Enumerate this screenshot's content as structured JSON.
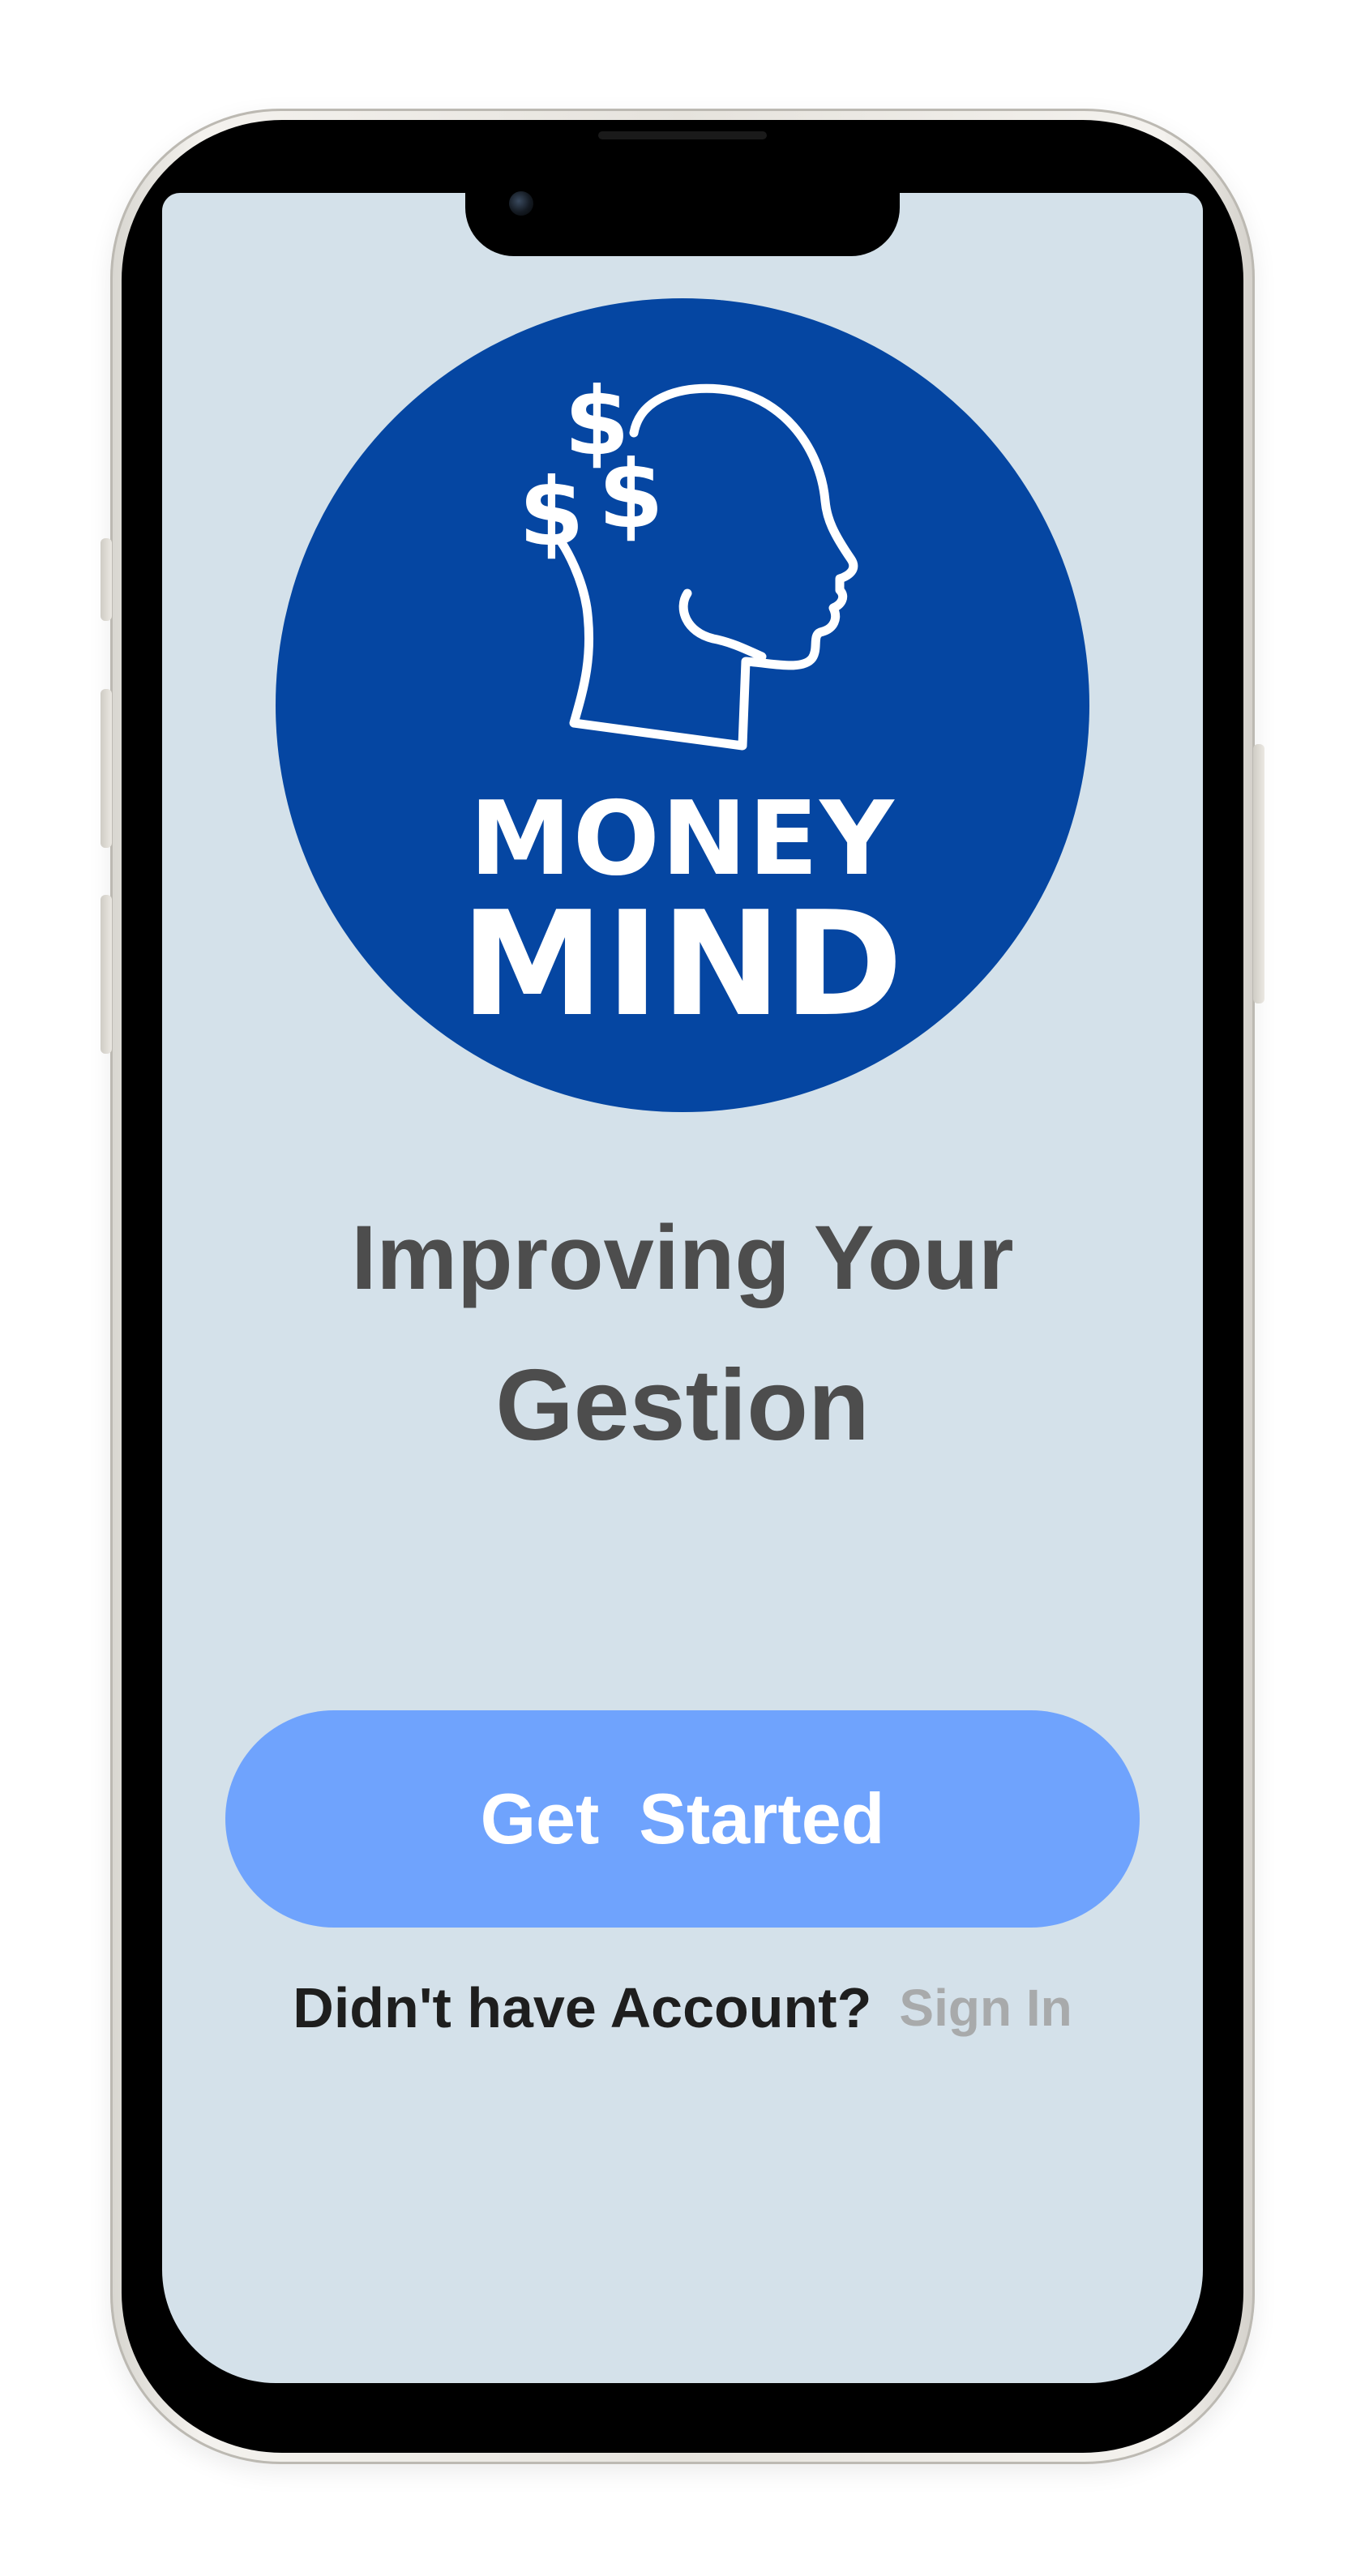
{
  "logo": {
    "word_top": "MONEY",
    "word_bottom": "MIND",
    "icon": "head-with-dollar-signs-icon",
    "circle_color": "#0546a2"
  },
  "headline": {
    "line1": "Improving Your",
    "line2": "Gestion"
  },
  "cta": {
    "label": "Get  Started",
    "color": "#6fa3fd"
  },
  "account": {
    "question": "Didn't have Account?",
    "link": "Sign In"
  },
  "theme": {
    "screen_background": "#d4e1ea",
    "headline_color": "#4d4d4d"
  }
}
